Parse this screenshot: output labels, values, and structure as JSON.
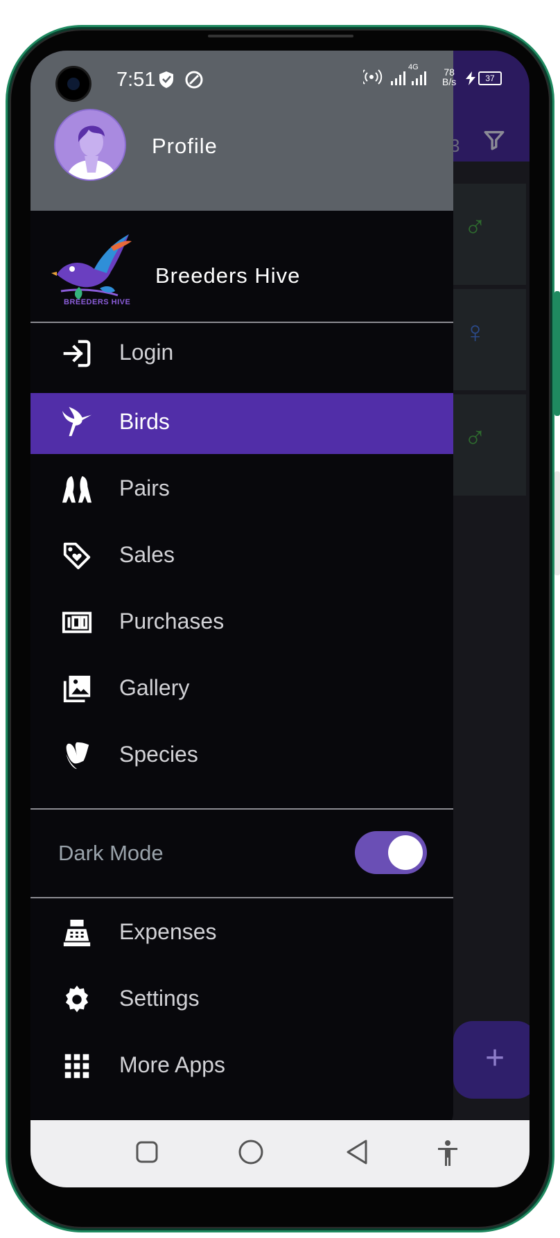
{
  "status_bar": {
    "time": "7:51",
    "net_rate_top": "78",
    "net_rate_bottom": "B/s",
    "network_type": "4G",
    "battery": "37"
  },
  "background_app": {
    "count_text": "3",
    "fab_label": "+",
    "genders": [
      "♂",
      "♀",
      "♂"
    ],
    "male_color": "#2e6b2e",
    "female_color": "#2b4a8a"
  },
  "drawer": {
    "profile_label": "Profile",
    "brand_name": "Breeders Hive",
    "logo_caption": "BREEDERS HIVE",
    "main_items": [
      {
        "label": "Login",
        "icon": "login-icon",
        "active": false
      },
      {
        "label": "Birds",
        "icon": "hummingbird-icon",
        "active": true
      },
      {
        "label": "Pairs",
        "icon": "bird-pair-icon",
        "active": false
      },
      {
        "label": "Sales",
        "icon": "tag-heart-icon",
        "active": false
      },
      {
        "label": "Purchases",
        "icon": "money-icon",
        "active": false
      },
      {
        "label": "Gallery",
        "icon": "image-multiple-icon",
        "active": false
      },
      {
        "label": "Species",
        "icon": "typo3-icon",
        "active": false
      }
    ],
    "dark_mode": {
      "label": "Dark Mode",
      "enabled": true
    },
    "secondary_items": [
      {
        "label": "Expenses",
        "icon": "cash-register-icon"
      },
      {
        "label": "Settings",
        "icon": "gear-icon"
      },
      {
        "label": "More Apps",
        "icon": "grid-icon"
      }
    ]
  },
  "colors": {
    "drawer_bg": "#08080c",
    "profile_header_bg": "#5c6167",
    "active_item_bg": "#512ea8",
    "toggle_track": "#6a4fb5",
    "app_header": "#2b1a5e"
  }
}
